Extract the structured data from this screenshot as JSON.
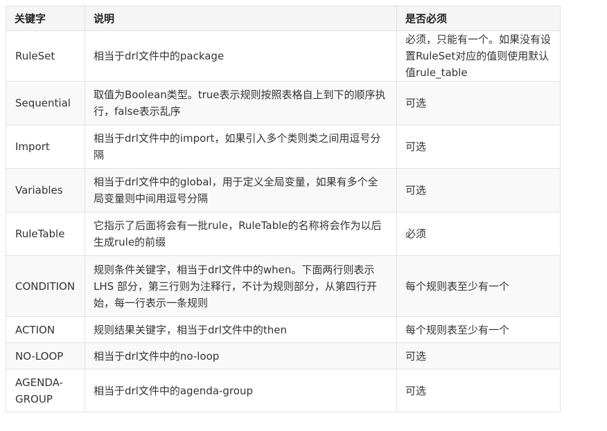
{
  "table": {
    "headers": [
      "关键字",
      "说明",
      "是否必须"
    ],
    "rows": [
      {
        "keyword": "RuleSet",
        "description": "相当于drl文件中的package",
        "required": "必须，只能有一个。如果没有设置RuleSet对应的值则使用默认值rule_table"
      },
      {
        "keyword": "Sequential",
        "description": "取值为Boolean类型。true表示规则按照表格自上到下的顺序执行，false表示乱序",
        "required": "可选"
      },
      {
        "keyword": "Import",
        "description": "相当于drl文件中的import，如果引入多个类则类之间用逗号分隔",
        "required": "可选"
      },
      {
        "keyword": "Variables",
        "description": "相当于drl文件中的global，用于定义全局变量，如果有多个全局变量则中间用逗号分隔",
        "required": "可选"
      },
      {
        "keyword": "RuleTable",
        "description": "它指示了后面将会有一批rule，RuleTable的名称将会作为以后生成rule的前缀",
        "required": "必须"
      },
      {
        "keyword": "CONDITION",
        "description": "规则条件关键字，相当于drl文件中的when。下面两行则表示 LHS 部分，第三行则为注释行，不计为规则部分，从第四行开始，每一行表示一条规则",
        "required": "每个规则表至少有一个"
      },
      {
        "keyword": "ACTION",
        "description": "规则结果关键字，相当于drl文件中的then",
        "required": "每个规则表至少有一个"
      },
      {
        "keyword": "NO-LOOP",
        "description": "相当于drl文件中的no-loop",
        "required": "可选"
      },
      {
        "keyword": "AGENDA-GROUP",
        "description": "相当于drl文件中的agenda-group",
        "required": "可选"
      }
    ]
  }
}
